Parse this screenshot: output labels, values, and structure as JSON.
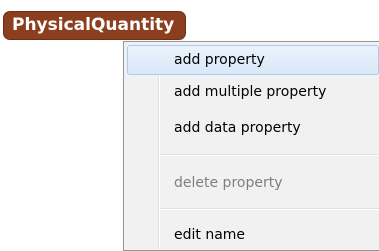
{
  "node": {
    "label": "PhysicalQuantity"
  },
  "menu": {
    "items": [
      {
        "label": "add property",
        "enabled": true,
        "highlighted": true
      },
      {
        "label": "add multiple property",
        "enabled": true,
        "highlighted": false
      },
      {
        "label": "add data property",
        "enabled": true,
        "highlighted": false
      },
      {
        "label": "delete property",
        "enabled": false,
        "highlighted": false
      },
      {
        "label": "edit name",
        "enabled": true,
        "highlighted": false
      }
    ]
  },
  "colors": {
    "node_background": "#8b3f1e",
    "menu_background": "#f1f1f1",
    "highlight_border": "#aacbed",
    "disabled_text": "#7f7f7f"
  }
}
